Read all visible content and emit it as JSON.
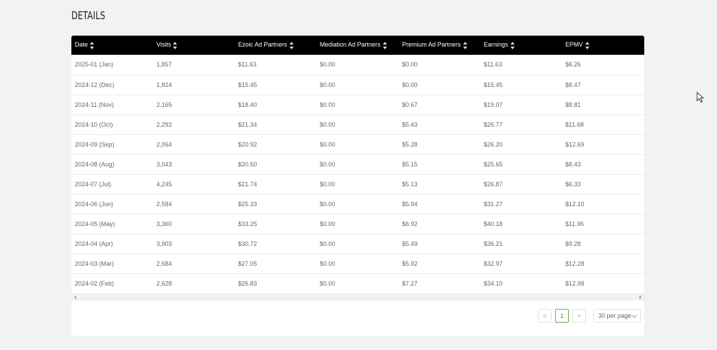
{
  "section_title": "DETAILS",
  "table": {
    "columns": [
      "Date",
      "Visits",
      "Ezoic Ad Partners",
      "Mediation Ad Partners",
      "Premium Ad Partners",
      "Earnings",
      "EPMV"
    ],
    "rows": [
      [
        "2025-01 (Jan)",
        "1,857",
        "$11.63",
        "$0.00",
        "$0.00",
        "$11.63",
        "$6.26"
      ],
      [
        "2024-12 (Dec)",
        "1,824",
        "$15.45",
        "$0.00",
        "$0.00",
        "$15.45",
        "$8.47"
      ],
      [
        "2024-11 (Nov)",
        "2,165",
        "$18.40",
        "$0.00",
        "$0.67",
        "$19.07",
        "$8.81"
      ],
      [
        "2024-10 (Oct)",
        "2,292",
        "$21.34",
        "$0.00",
        "$5.43",
        "$26.77",
        "$11.68"
      ],
      [
        "2024-09 (Sep)",
        "2,064",
        "$20.92",
        "$0.00",
        "$5.28",
        "$26.20",
        "$12.69"
      ],
      [
        "2024-08 (Aug)",
        "3,043",
        "$20.50",
        "$0.00",
        "$5.15",
        "$25.65",
        "$8.43"
      ],
      [
        "2024-07 (Jul)",
        "4,245",
        "$21.74",
        "$0.00",
        "$5.13",
        "$26.87",
        "$6.33"
      ],
      [
        "2024-06 (Jun)",
        "2,584",
        "$25.33",
        "$0.00",
        "$5.94",
        "$31.27",
        "$12.10"
      ],
      [
        "2024-05 (May)",
        "3,360",
        "$33.25",
        "$0.00",
        "$6.92",
        "$40.18",
        "$11.96"
      ],
      [
        "2024-04 (Apr)",
        "3,903",
        "$30.72",
        "$0.00",
        "$5.49",
        "$36.21",
        "$9.28"
      ],
      [
        "2024-03 (Mar)",
        "2,684",
        "$27.05",
        "$0.00",
        "$5.92",
        "$32.97",
        "$12.28"
      ],
      [
        "2024-02 (Feb)",
        "2,628",
        "$26.83",
        "$0.00",
        "$7.27",
        "$34.10",
        "$12.98"
      ]
    ]
  },
  "pagination": {
    "prev_label": "<",
    "current_page": "1",
    "next_label": ">",
    "page_size_label": "30 per page"
  },
  "colors": {
    "header_bg": "#000000",
    "active_page": "#6aab3a"
  },
  "icons": {
    "sort": "sort-icon",
    "scroll_left": "scroll-left-icon",
    "scroll_right": "scroll-right-icon",
    "dropdown": "chevron-down-icon",
    "cursor": "mouse-pointer-icon"
  }
}
